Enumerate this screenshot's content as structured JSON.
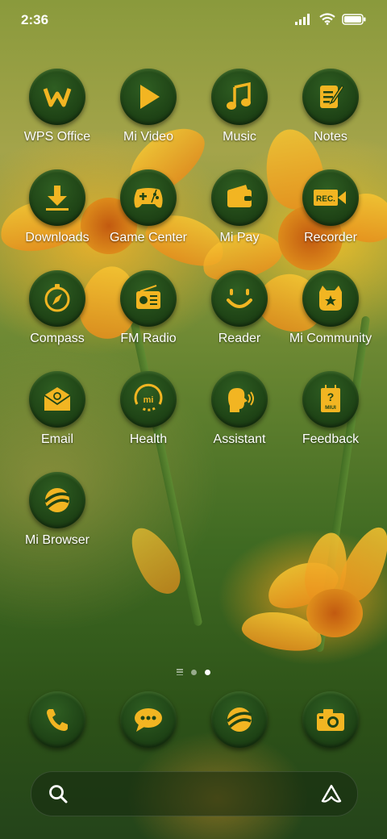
{
  "status_bar": {
    "time": "2:36"
  },
  "apps": [
    {
      "label": "WPS Office",
      "icon": "wps-office-icon"
    },
    {
      "label": "Mi Video",
      "icon": "mi-video-icon"
    },
    {
      "label": "Music",
      "icon": "music-icon"
    },
    {
      "label": "Notes",
      "icon": "notes-icon"
    },
    {
      "label": "Downloads",
      "icon": "downloads-icon"
    },
    {
      "label": "Game Center",
      "icon": "game-center-icon"
    },
    {
      "label": "Mi Pay",
      "icon": "mi-pay-icon"
    },
    {
      "label": "Recorder",
      "icon": "recorder-icon"
    },
    {
      "label": "Compass",
      "icon": "compass-icon"
    },
    {
      "label": "FM Radio",
      "icon": "fm-radio-icon"
    },
    {
      "label": "Reader",
      "icon": "reader-icon"
    },
    {
      "label": "Mi Community",
      "icon": "mi-community-icon"
    },
    {
      "label": "Email",
      "icon": "email-icon"
    },
    {
      "label": "Health",
      "icon": "health-icon"
    },
    {
      "label": "Assistant",
      "icon": "assistant-icon"
    },
    {
      "label": "Feedback",
      "icon": "feedback-icon"
    },
    {
      "label": "Mi Browser",
      "icon": "mi-browser-icon"
    }
  ],
  "icon_text": {
    "recorder": "REC.",
    "feedback_question": "?",
    "feedback_brand": "MIUI",
    "health_brand": "mi"
  },
  "dock": [
    {
      "icon": "phone-icon"
    },
    {
      "icon": "messages-icon"
    },
    {
      "icon": "browser-icon"
    },
    {
      "icon": "camera-icon"
    }
  ],
  "pager": {
    "pages": 2,
    "current": 2
  },
  "colors": {
    "icon_glyph": "#f2b522",
    "icon_bg": "#1f4416"
  }
}
